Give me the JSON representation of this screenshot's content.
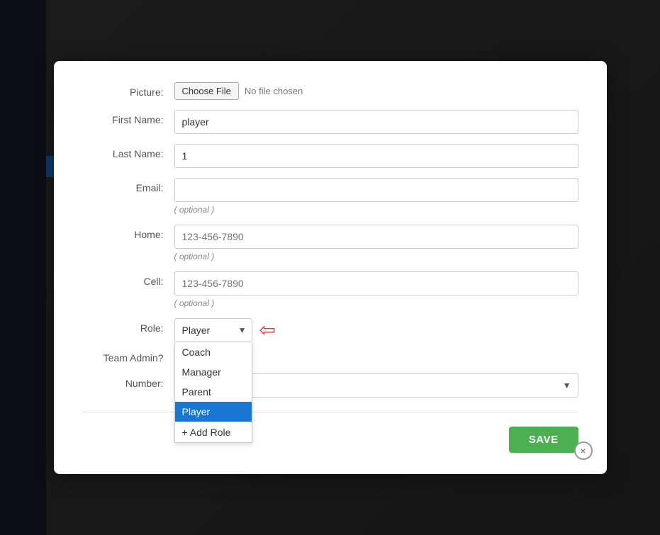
{
  "background": {
    "color": "#2c2c2c"
  },
  "modal": {
    "fields": {
      "picture": {
        "label": "Picture:",
        "choose_file_btn": "Choose File",
        "no_file_text": "No file chosen"
      },
      "first_name": {
        "label": "First Name:",
        "value": "player",
        "placeholder": ""
      },
      "last_name": {
        "label": "Last Name:",
        "value": "1",
        "placeholder": ""
      },
      "email": {
        "label": "Email:",
        "value": "",
        "placeholder": "",
        "optional": "( optional )"
      },
      "home": {
        "label": "Home:",
        "value": "",
        "placeholder": "123-456-7890",
        "optional": "( optional )"
      },
      "cell": {
        "label": "Cell:",
        "value": "",
        "placeholder": "123-456-7890",
        "optional": "( optional )"
      },
      "role": {
        "label": "Role:",
        "selected": "Player",
        "options": [
          "Coach",
          "Manager",
          "Parent",
          "Player",
          "+ Add Role"
        ]
      },
      "team_admin": {
        "label": "Team Admin?",
        "checked": false
      },
      "number": {
        "label": "Number:",
        "value": "",
        "placeholder": ""
      }
    },
    "save_button": "SAVE",
    "close_icon": "×"
  }
}
